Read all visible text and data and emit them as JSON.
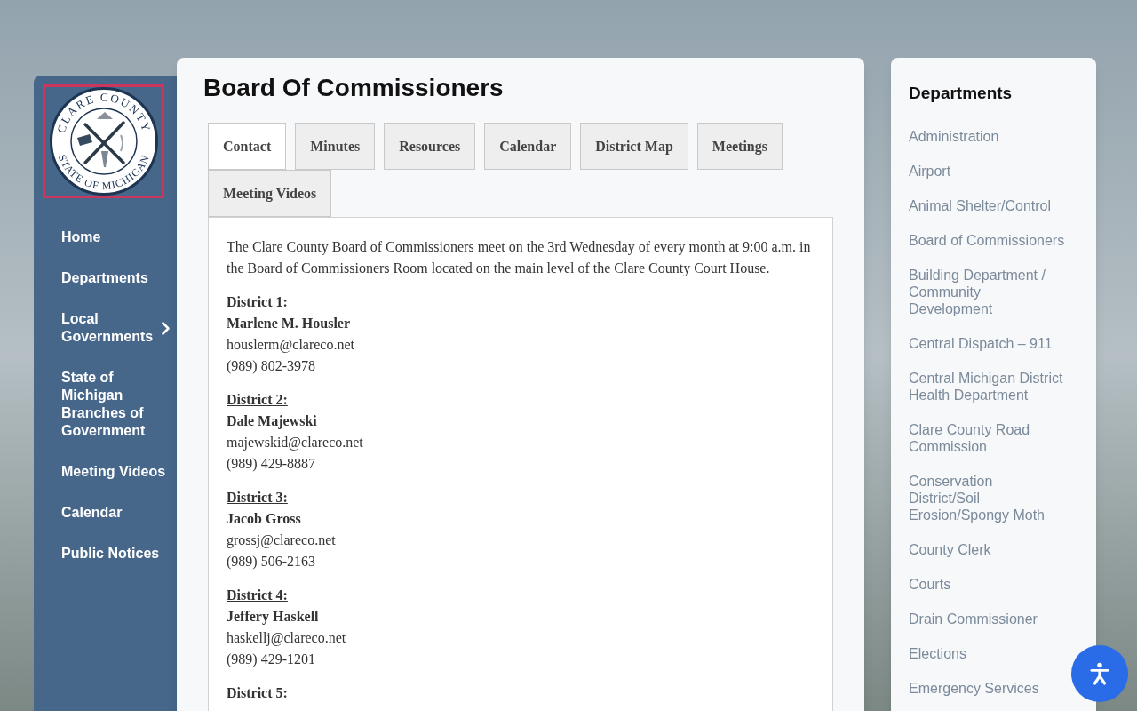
{
  "logo": {
    "top_text": "CLARE COUNTY",
    "bottom_text": "STATE OF MICHIGAN"
  },
  "nav": [
    {
      "label": "Home",
      "submenu": false
    },
    {
      "label": "Departments",
      "submenu": false
    },
    {
      "label": "Local Governments",
      "submenu": true
    },
    {
      "label": "State of Michigan Branches of Government",
      "submenu": false
    },
    {
      "label": "Meeting Videos",
      "submenu": false
    },
    {
      "label": "Calendar",
      "submenu": false
    },
    {
      "label": "Public Notices",
      "submenu": false
    }
  ],
  "page": {
    "title": "Board Of Commissioners",
    "tabs": [
      {
        "label": "Contact",
        "selected": true
      },
      {
        "label": "Minutes",
        "selected": false
      },
      {
        "label": "Resources",
        "selected": false
      },
      {
        "label": "Calendar",
        "selected": false
      },
      {
        "label": "District Map",
        "selected": false
      },
      {
        "label": "Meetings",
        "selected": false
      },
      {
        "label": "Meeting Videos",
        "selected": false
      }
    ],
    "intro": "The Clare County Board of Commissioners meet on the 3rd Wednesday of every month at 9:00 a.m. in the Board of Commissioners Room located on the main level of the Clare County Court House.",
    "districts": [
      {
        "heading": "District 1:",
        "name": "Marlene M. Housler",
        "email": "houslerm@clareco.net",
        "phone": "(989) 802-3978"
      },
      {
        "heading": "District 2:",
        "name": "Dale Majewski",
        "email": "majewskid@clareco.net",
        "phone": "(989) 429-8887"
      },
      {
        "heading": "District 3:",
        "name": "Jacob Gross",
        "email": "grossj@clareco.net",
        "phone": "(989) 506-2163"
      },
      {
        "heading": "District 4:",
        "name": "Jeffery Haskell",
        "email": "haskellj@clareco.net",
        "phone": "(989) 429-1201"
      },
      {
        "heading": "District 5:"
      }
    ]
  },
  "sidebar": {
    "title": "Departments",
    "items": [
      "Administration",
      "Airport",
      "Animal Shelter/Control",
      "Board of Commissioners",
      "Building Department / Community Development",
      "Central Dispatch – 911",
      "Central Michigan District Health Department",
      "Clare County Road Commission",
      "Conservation District/Soil Erosion/Spongy Moth",
      "County Clerk",
      "Courts",
      "Drain Commissioner",
      "Elections",
      "Emergency Services"
    ]
  }
}
